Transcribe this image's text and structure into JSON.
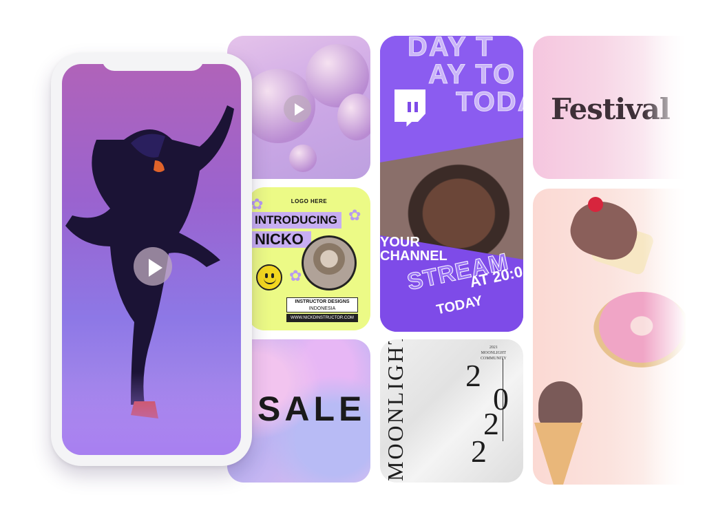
{
  "phone": {
    "play_icon": "play-icon"
  },
  "spheres_tile": {
    "play_icon": "play-icon"
  },
  "intro_tile": {
    "logo_text": "LOGO HERE",
    "line1": "INTRODUCING",
    "line2": "NICKO",
    "designs": "INSTRUCTOR DESIGNS",
    "country": "INDONESIA",
    "url": "WWW.NICKDINSTRUCTOR.COM"
  },
  "sale_tile": {
    "word": "SALE"
  },
  "twitch_tile": {
    "bg_text_1": "DAY T",
    "bg_text_2": "AY TO",
    "bg_text_3": "TODA",
    "your": "YOUR",
    "channel": "CHANNEL",
    "stream": "STREAM",
    "at": "AT 20:0",
    "today": "TODAY",
    "icon": "twitch-logo-icon"
  },
  "moon_tile": {
    "word": "MOONLIGHT",
    "meta_year": "2021",
    "meta_1": "MOONLIGHT",
    "meta_2": "COMMUNITY",
    "d1": "2",
    "d2": "0",
    "d3": "2",
    "d4": "2"
  },
  "festival_tile": {
    "word": "Festival"
  },
  "colors": {
    "accent": "#7e4be8",
    "lime": "#ecfa86",
    "lavender": "#c7aef2"
  }
}
